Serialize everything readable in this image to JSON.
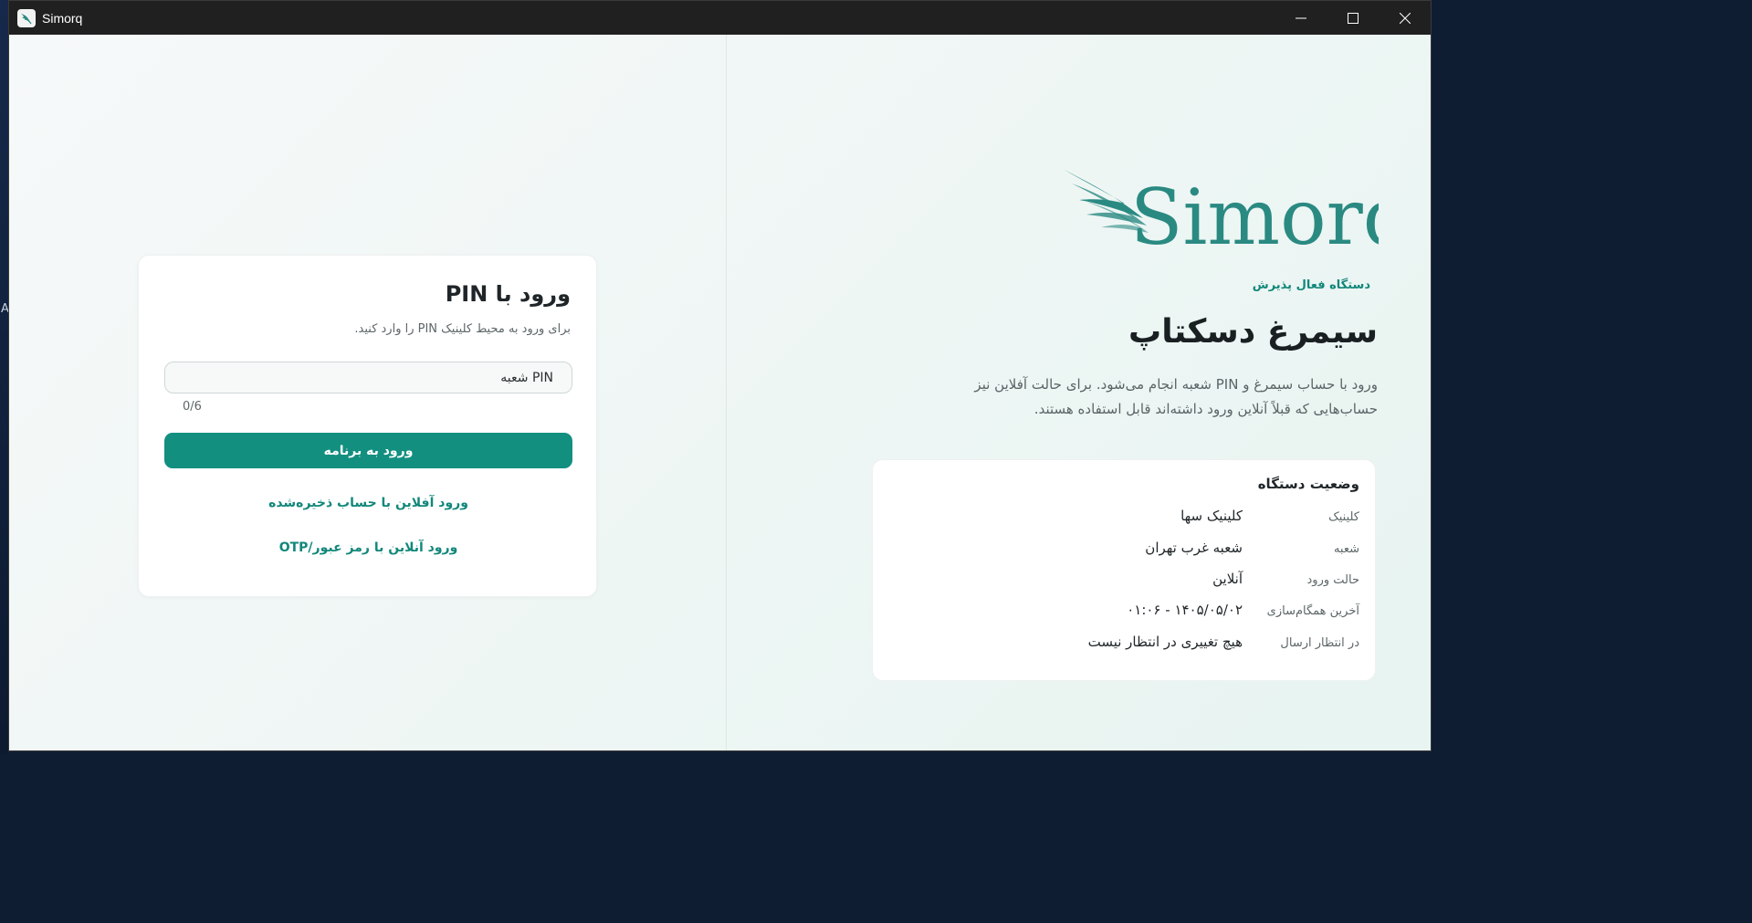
{
  "window": {
    "title": "Simorq",
    "desktop_letter": "A",
    "controls": [
      "minimize",
      "maximize",
      "close"
    ]
  },
  "login": {
    "title": "ورود با PIN",
    "subtitle": "برای ورود به محیط کلینیک PIN را وارد کنید.",
    "pin_placeholder": "PIN شعبه",
    "pin_value": "",
    "pin_counter": "0/6",
    "submit_label": "ورود به برنامه",
    "offline_link": "ورود آفلاین با حساب ذخیره‌شده",
    "otp_link": "ورود آنلاین با رمز عبور/OTP"
  },
  "brand": {
    "logo_text": "Simorq",
    "kicker": "دستگاه فعال پذیرش",
    "title": "سیمرغ دسکتاپ",
    "description": "ورود با حساب سیمرغ و PIN شعبه انجام می‌شود. برای حالت آفلاین نیز حساب‌هایی که قبلاً آنلاین ورود داشته‌اند قابل استفاده هستند.",
    "accent_color": "#138f80",
    "logo_color": "#2a8a82"
  },
  "device_status": {
    "title": "وضعیت دستگاه",
    "rows": [
      {
        "key": "کلینیک",
        "value": "کلینیک سها"
      },
      {
        "key": "شعبه",
        "value": "شعبه غرب تهران"
      },
      {
        "key": "حالت ورود",
        "value": "آنلاین"
      },
      {
        "key": "آخرین همگام‌سازی",
        "value": "۱۴۰۵/۰۵/۰۲ - ۰۱:۰۶"
      },
      {
        "key": "در انتظار ارسال",
        "value": "هیچ تغییری در انتظار نیست"
      }
    ]
  }
}
